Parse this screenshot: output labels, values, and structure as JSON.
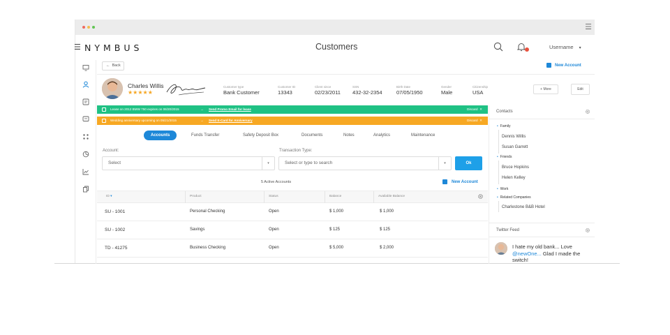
{
  "window": {
    "menu_icon": "hamburger-icon"
  },
  "header": {
    "brand": "NYMBUS",
    "title": "Customers",
    "username": "Username",
    "caret": "▾"
  },
  "toolbar": {
    "back_label": "Back",
    "new_account_label": "New Account"
  },
  "customer": {
    "name": "Charles Willis",
    "stars": "★★★★★",
    "fields": [
      {
        "label": "Customer type",
        "value": "Bank Customer"
      },
      {
        "label": "Customer ID",
        "value": "13343"
      },
      {
        "label": "Client since",
        "value": "02/23/2011"
      },
      {
        "label": "SSN",
        "value": "432-32-2354"
      },
      {
        "label": "Birth Date",
        "value": "07/05/1950"
      },
      {
        "label": "Gender",
        "value": "Male"
      },
      {
        "label": "Citizenship",
        "value": "USA"
      }
    ],
    "more_label": "+ More",
    "edit_label": "Edit"
  },
  "alerts": [
    {
      "message": "Lease on 2012 BMW 750 expires on 06/20/2015",
      "action": "Send Promo Email for lease",
      "discard": "Discard",
      "color": "#1fc184"
    },
    {
      "message": "Wedding anniversary upcoming on 05/21/2015",
      "action": "Send E-Card for Anniversary",
      "discard": "Discard",
      "color": "#f7a823"
    }
  ],
  "tabs": [
    "Accounts",
    "Funds Transfer",
    "Safety Deposit Box",
    "Documents",
    "Notes",
    "Analytics",
    "Maintenance"
  ],
  "form": {
    "account_label": "Account:",
    "account_placeholder": "Select",
    "transaction_label": "Transaction Type:",
    "transaction_placeholder": "Select or type to search",
    "ok_label": "Ok"
  },
  "accounts": {
    "count_label": "5 Active Accounts",
    "new_account_label": "New Account",
    "columns": [
      "ID",
      "Product",
      "Status",
      "Balance",
      "Available Balance"
    ],
    "rows": [
      {
        "id": "SU - 1001",
        "product": "Personal Checking",
        "status": "Open",
        "balance": "$ 1,000",
        "available": "$ 1,000"
      },
      {
        "id": "SU - 1002",
        "product": "Savings",
        "status": "Open",
        "balance": "$ 125",
        "available": "$ 125"
      },
      {
        "id": "TD - 41275",
        "product": "Business Checking",
        "status": "Open",
        "balance": "$ 5,000",
        "available": "$ 2,000"
      }
    ]
  },
  "contacts": {
    "title": "Contacts",
    "groups": {
      "family": {
        "label": "Family",
        "members": [
          "Dennis Willis",
          "Susan Garrett"
        ]
      },
      "friends": {
        "label": "Friends",
        "members": [
          "Bruce Hopkins",
          "Helen Kelley"
        ]
      },
      "work": {
        "label": "Work"
      },
      "companies": {
        "label": "Related Companies",
        "members": [
          "Charlestone B&B Hotel"
        ]
      }
    }
  },
  "twitter": {
    "title": "Twitter Feed",
    "tweet_pre": "I hate my old bank... Love",
    "tweet_mention": "@newOne...",
    "tweet_post": "Glad I made the switch!"
  },
  "colors": {
    "accent": "#1e88d8",
    "green": "#1fc184",
    "orange": "#f7a823",
    "star": "#f5a623"
  }
}
